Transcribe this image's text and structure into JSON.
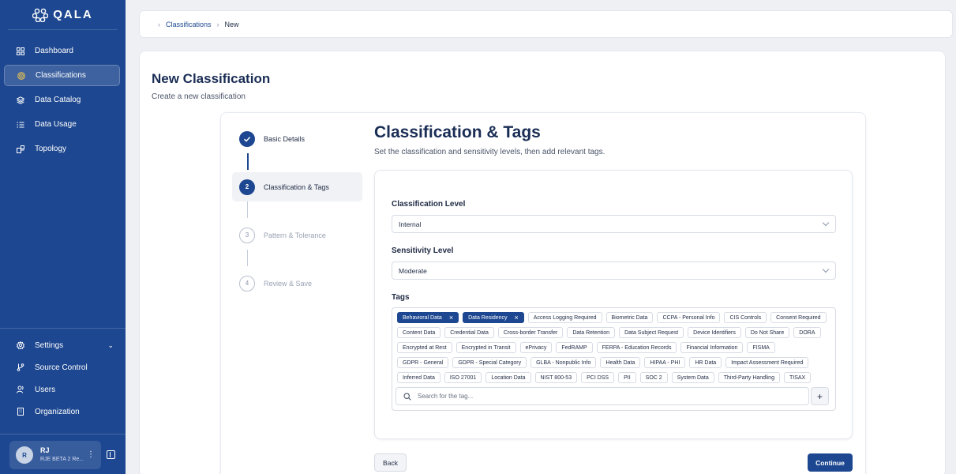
{
  "app": {
    "logo_text": "QALA"
  },
  "sidebar": {
    "items": [
      {
        "label": "Dashboard",
        "icon": "grid-icon"
      },
      {
        "label": "Classifications",
        "icon": "target-icon",
        "active": true
      },
      {
        "label": "Data Catalog",
        "icon": "layers-icon"
      },
      {
        "label": "Data Usage",
        "icon": "list-icon"
      },
      {
        "label": "Topology",
        "icon": "topology-icon"
      }
    ],
    "bottom_items": [
      {
        "label": "Settings",
        "icon": "gear-icon"
      },
      {
        "label": "Source Control",
        "icon": "branch-icon"
      },
      {
        "label": "Users",
        "icon": "users-icon"
      },
      {
        "label": "Organization",
        "icon": "building-icon"
      }
    ],
    "user": {
      "initial": "R",
      "name": "RJ",
      "org": "RJE BETA 2 Re..."
    }
  },
  "breadcrumb": {
    "items": [
      "Classifications",
      "New"
    ]
  },
  "page": {
    "title": "New Classification",
    "subtitle": "Create a new classification"
  },
  "stepper": {
    "steps": [
      {
        "number": "",
        "label": "Basic Details",
        "state": "done"
      },
      {
        "number": "2",
        "label": "Classification & Tags",
        "state": "current"
      },
      {
        "number": "3",
        "label": "Pattern & Tolerance",
        "state": "todo"
      },
      {
        "number": "4",
        "label": "Review & Save",
        "state": "todo"
      }
    ]
  },
  "form": {
    "title": "Classification & Tags",
    "subtitle": "Set the classification and sensitivity levels, then add relevant tags.",
    "classification_level": {
      "label": "Classification Level",
      "value": "Internal"
    },
    "sensitivity_level": {
      "label": "Sensitivity Level",
      "value": "Moderate"
    },
    "tags": {
      "label": "Tags",
      "selected": [
        "Behavioral Data",
        "Data Residency"
      ],
      "available": [
        "Access Logging Required",
        "Biometric Data",
        "CCPA - Personal Info",
        "CIS Controls",
        "Consent Required",
        "Content Data",
        "Credential Data",
        "Cross-border Transfer",
        "Data Retention",
        "Data Subject Request",
        "Device Identifiers",
        "Do Not Share",
        "DORA",
        "Encrypted at Rest",
        "Encrypted in Transit",
        "ePrivacy",
        "FedRAMP",
        "FERPA - Education Records",
        "Financial Information",
        "FISMA",
        "GDPR - General",
        "GDPR - Special Category",
        "GLBA - Nonpublic Info",
        "Health Data",
        "HIPAA - PHI",
        "HR Data",
        "Impact Assessment Required",
        "Inferred Data",
        "ISO 27001",
        "Location Data",
        "NIST 800-53",
        "PCI DSS",
        "PII",
        "SOC 2",
        "System Data",
        "Third-Party Handling",
        "TISAX"
      ],
      "search_placeholder": "Search for the tag...",
      "add_label": "+"
    },
    "back_label": "Back",
    "continue_label": "Continue"
  },
  "colors": {
    "brand": "#1d4790",
    "background": "#eef0f4"
  }
}
